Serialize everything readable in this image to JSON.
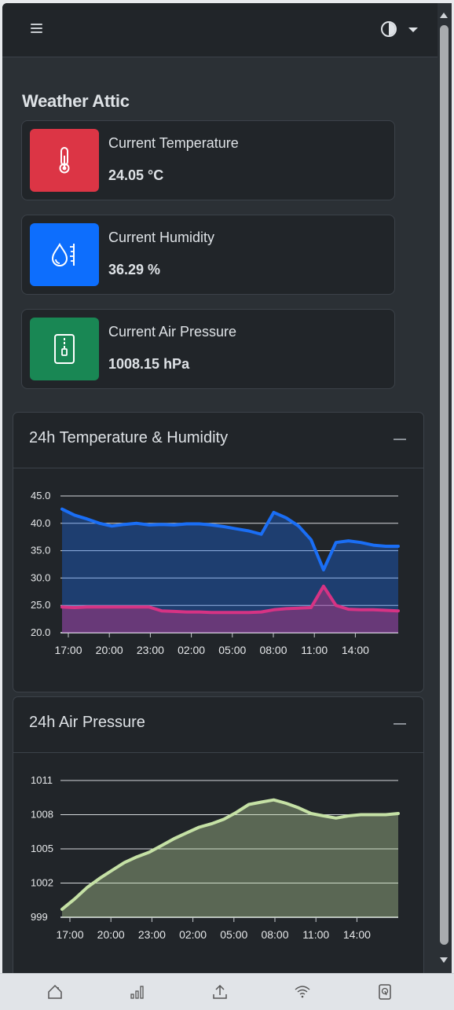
{
  "header": {
    "menu_icon": "hamburger-icon",
    "theme_icon": "contrast-icon"
  },
  "page_title": "Weather Attic",
  "stats": [
    {
      "label": "Current Temperature",
      "value": "24.05 °C",
      "icon": "thermometer-icon",
      "color": "#dc3545"
    },
    {
      "label": "Current Humidity",
      "value": "36.29 %",
      "icon": "droplet-gauge-icon",
      "color": "#0d6efd"
    },
    {
      "label": "Current Air Pressure",
      "value": "1008.15 hPa",
      "icon": "pressure-file-icon",
      "color": "#198754"
    }
  ],
  "panels": {
    "temp_humidity": {
      "title": "24h Temperature & Humidity"
    },
    "pressure": {
      "title": "24h Air Pressure"
    }
  },
  "chart_data": [
    {
      "type": "area",
      "title": "24h Temperature & Humidity",
      "x": [
        "17:00",
        "18:00",
        "19:00",
        "20:00",
        "21:00",
        "22:00",
        "23:00",
        "00:00",
        "01:00",
        "02:00",
        "03:00",
        "04:00",
        "05:00",
        "06:00",
        "07:00",
        "08:00",
        "09:00",
        "10:00",
        "10:30",
        "11:00",
        "12:00",
        "12:30",
        "13:00",
        "13:30",
        "14:00",
        "15:00",
        "16:00",
        "17:00"
      ],
      "xticks": [
        "17:00",
        "20:00",
        "23:00",
        "02:00",
        "05:00",
        "08:00",
        "11:00",
        "14:00"
      ],
      "yticks": [
        "45.0",
        "40.0",
        "35.0",
        "30.0",
        "25.0",
        "20.0"
      ],
      "ylim": [
        20,
        45
      ],
      "series": [
        {
          "color": "#1a6ef5",
          "values": [
            42.6,
            41.5,
            40.8,
            40.0,
            39.5,
            39.8,
            40.0,
            39.7,
            39.8,
            39.7,
            39.9,
            39.9,
            39.7,
            39.4,
            39.0,
            38.6,
            38.0,
            42.0,
            41.0,
            39.5,
            37.0,
            31.5,
            36.5,
            36.8,
            36.5,
            36.0,
            35.8,
            35.8
          ]
        },
        {
          "color": "#d63384",
          "values": [
            24.7,
            24.6,
            24.7,
            24.7,
            24.7,
            24.7,
            24.7,
            24.7,
            24.0,
            23.9,
            23.8,
            23.8,
            23.7,
            23.7,
            23.7,
            23.7,
            23.8,
            24.2,
            24.4,
            24.5,
            24.6,
            28.5,
            25.0,
            24.3,
            24.2,
            24.2,
            24.1,
            24.0
          ]
        }
      ]
    },
    {
      "type": "area",
      "title": "24h Air Pressure",
      "x": [
        "17:00",
        "18:00",
        "19:00",
        "20:00",
        "21:00",
        "22:00",
        "23:00",
        "00:00",
        "01:00",
        "02:00",
        "03:00",
        "04:00",
        "05:00",
        "06:00",
        "07:00",
        "08:00",
        "09:00",
        "10:00",
        "10:30",
        "11:00",
        "12:00",
        "12:30",
        "13:00",
        "13:30",
        "14:00",
        "15:00",
        "16:00",
        "17:00"
      ],
      "xticks": [
        "17:00",
        "20:00",
        "23:00",
        "02:00",
        "05:00",
        "08:00",
        "11:00",
        "14:00"
      ],
      "yticks": [
        "1011",
        "1008",
        "1005",
        "1002",
        "999"
      ],
      "ylim": [
        999,
        1011
      ],
      "series": [
        {
          "color": "#c5e1a5",
          "values": [
            999.7,
            1000.6,
            1001.6,
            1002.4,
            1003.1,
            1003.8,
            1004.3,
            1004.7,
            1005.3,
            1005.9,
            1006.4,
            1006.9,
            1007.2,
            1007.6,
            1008.2,
            1008.9,
            1009.1,
            1009.3,
            1009.0,
            1008.6,
            1008.1,
            1007.9,
            1007.7,
            1007.9,
            1008.0,
            1008.0,
            1008.0,
            1008.1
          ]
        }
      ]
    }
  ],
  "bottom_nav": [
    "home-icon",
    "bar-chart-icon",
    "upload-icon",
    "wifi-icon",
    "device-icon"
  ]
}
